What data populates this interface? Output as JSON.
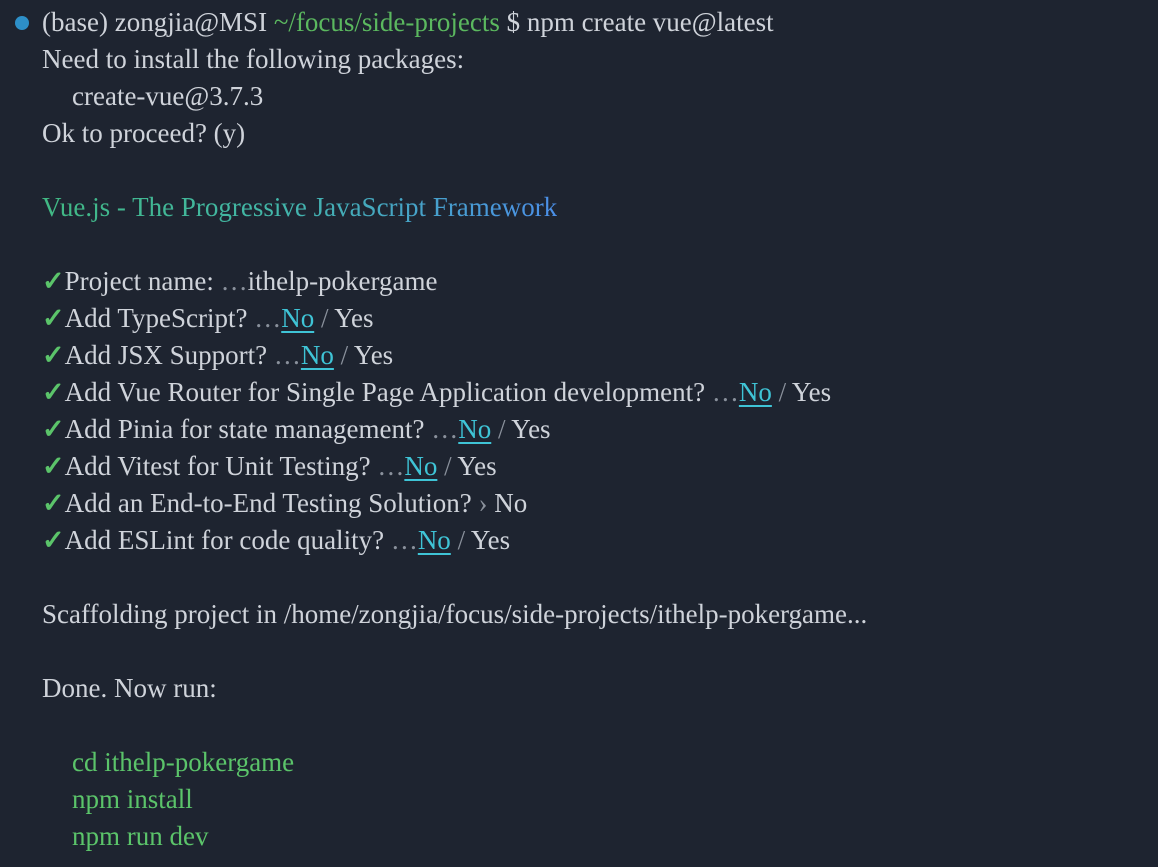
{
  "prompt": {
    "env": "(base)",
    "user_host": "zongjia@MSI",
    "path": "~/focus/side-projects",
    "symbol": "$",
    "command": "npm create vue@latest"
  },
  "install": {
    "notice": "Need to install the following packages:",
    "package": "create-vue@3.7.3",
    "confirm": "Ok to proceed? (y)"
  },
  "banner": "Vue.js - The Progressive JavaScript Framework",
  "questions": [
    {
      "check": "✓",
      "label": "Project name:",
      "sep": "…",
      "answer": "ithelp-pokergame"
    },
    {
      "check": "✓",
      "label": "Add TypeScript?",
      "sep": "…",
      "selected": "No",
      "slash": "/",
      "other": "Yes"
    },
    {
      "check": "✓",
      "label": "Add JSX Support?",
      "sep": "…",
      "selected": "No",
      "slash": "/",
      "other": "Yes"
    },
    {
      "check": "✓",
      "label": "Add Vue Router for Single Page Application development?",
      "sep": "…",
      "selected": "No",
      "slash": "/",
      "other": "Yes"
    },
    {
      "check": "✓",
      "label": "Add Pinia for state management?",
      "sep": "…",
      "selected": "No",
      "slash": "/",
      "other": "Yes"
    },
    {
      "check": "✓",
      "label": "Add Vitest for Unit Testing?",
      "sep": "…",
      "selected": "No",
      "slash": "/",
      "other": "Yes"
    },
    {
      "check": "✓",
      "label": "Add an End-to-End Testing Solution?",
      "sep": "›",
      "answer": "No"
    },
    {
      "check": "✓",
      "label": "Add ESLint for code quality?",
      "sep": "…",
      "selected": "No",
      "slash": "/",
      "other": "Yes"
    }
  ],
  "scaffold": "Scaffolding project in /home/zongjia/focus/side-projects/ithelp-pokergame...",
  "done": "Done. Now run:",
  "next_steps": [
    "cd ithelp-pokergame",
    "npm install",
    "npm run dev"
  ],
  "colors": {
    "background": "#1e2430",
    "text": "#cfd3da",
    "green": "#5bc46a",
    "cyan": "#3fc4d6",
    "prompt_dot": "#2d8fc8"
  }
}
